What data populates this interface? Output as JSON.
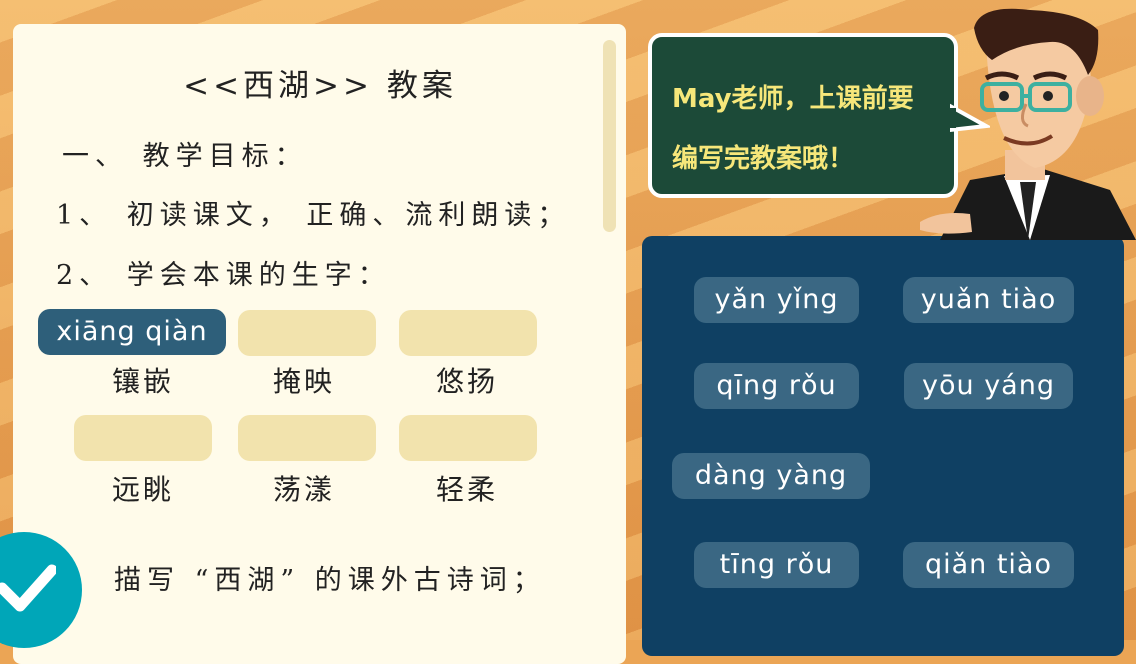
{
  "doc": {
    "title": "<<西湖>> 教案",
    "section1": "一、 教学目标：",
    "item1": "1、 初读课文， 正确、流利朗读；",
    "item2": "2、 学会本课的生字：",
    "item3": "描写 “西湖” 的课外古诗词；"
  },
  "answers": {
    "filled_pinyin": "xiāng qiàn"
  },
  "words": [
    "镶嵌",
    "掩映",
    "悠扬",
    "远眺",
    "荡漾",
    "轻柔"
  ],
  "options": [
    "yǎn yǐng",
    "yuǎn tiào",
    "qīng rǒu",
    "yōu yáng",
    "dàng yàng",
    "tīng rǒu",
    "qiǎn tiào"
  ],
  "speech": {
    "line1": "May老师，上课前要",
    "line2": "编写完教案哦！"
  },
  "colors": {
    "paper": "#fffbea",
    "board": "#0f4063",
    "option_pill": "#3a6783",
    "answer_slot": "#f2e3ad",
    "filled_slot": "#2e5f7a",
    "check": "#00a6b8",
    "speech_bg": "#1c4a38",
    "speech_text": "#f6e77a"
  },
  "icons": {
    "check": "check-icon",
    "teacher": "teacher-character"
  }
}
